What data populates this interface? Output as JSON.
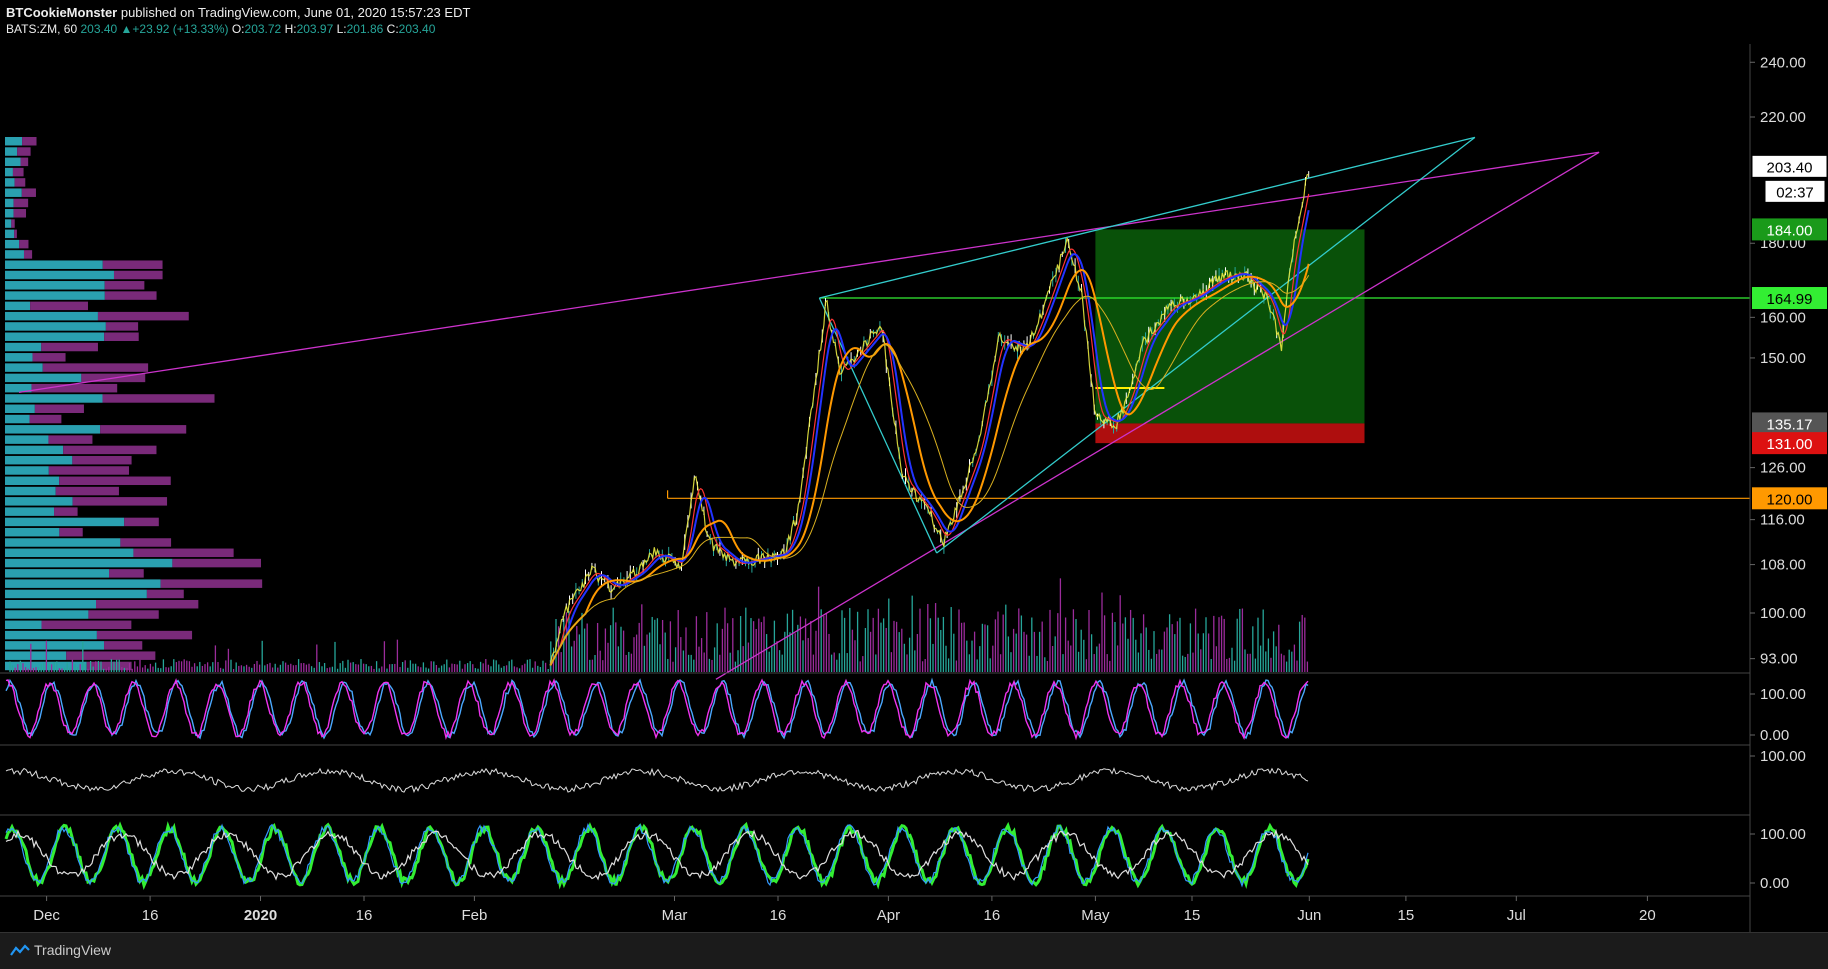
{
  "header": {
    "publisher": "BTCookieMonster",
    "published_text": " published on TradingView.com, June 01, 2020 15:57:23 EDT",
    "symbol_interval": "BATS:ZM, 60",
    "last": "203.40",
    "change": "+23.92 (+13.33%)",
    "o_label": "O:",
    "o_value": "203.72",
    "h_label": "H:",
    "h_value": "203.97",
    "l_label": "L:",
    "l_value": "201.86",
    "c_label": "C:",
    "c_value": "203.40"
  },
  "footer": {
    "brand": "TradingView"
  },
  "colors": {
    "background": "#000000",
    "up_teal": "#26a69a",
    "magenta": "#cc33cc",
    "cyan": "#33cccc",
    "orange": "#ff9900",
    "green_zone": "#0a5a0a",
    "red_zone": "#cc1111",
    "price_box_green": "#1a9a1a",
    "price_box_lime": "#33ee33",
    "price_box_red": "#dd1111",
    "price_box_orange": "#ff9900",
    "price_box_gray": "#555555"
  },
  "chart_data": {
    "type": "line",
    "title": "BATS:ZM, 60",
    "y_axis_ticks": [
      "240.00",
      "220.00",
      "180.00",
      "160.00",
      "150.00",
      "126.00",
      "116.00",
      "108.00",
      "100.00",
      "93.00"
    ],
    "y_scale": "log",
    "ylim": [
      90,
      250
    ],
    "x_axis_ticks": [
      "Dec",
      "16",
      "2020",
      "16",
      "Feb",
      "Mar",
      "16",
      "Apr",
      "16",
      "May",
      "15",
      "Jun",
      "15",
      "Jul",
      "20"
    ],
    "price_labels": [
      {
        "value": "203.40",
        "style": "last"
      },
      {
        "value": "02:37",
        "style": "countdown"
      },
      {
        "value": "184.00",
        "style": "target"
      },
      {
        "value": "164.99",
        "style": "level"
      },
      {
        "value": "135.17",
        "style": "entry"
      },
      {
        "value": "131.00",
        "style": "stop"
      },
      {
        "value": "120.00",
        "style": "support"
      }
    ],
    "price_series": [
      {
        "date": "2019-11-27",
        "price": null
      },
      {
        "date": "2020-01-31",
        "price": null
      },
      {
        "date": "2020-02-12",
        "price": 92
      },
      {
        "date": "2020-02-14",
        "price": 100
      },
      {
        "date": "2020-02-18",
        "price": 107
      },
      {
        "date": "2020-02-21",
        "price": 104
      },
      {
        "date": "2020-02-25",
        "price": 107
      },
      {
        "date": "2020-02-27",
        "price": 110
      },
      {
        "date": "2020-03-02",
        "price": 108
      },
      {
        "date": "2020-03-04",
        "price": 125
      },
      {
        "date": "2020-03-06",
        "price": 112
      },
      {
        "date": "2020-03-10",
        "price": 108
      },
      {
        "date": "2020-03-13",
        "price": 109
      },
      {
        "date": "2020-03-17",
        "price": 110
      },
      {
        "date": "2020-03-19",
        "price": 118
      },
      {
        "date": "2020-03-23",
        "price": 164
      },
      {
        "date": "2020-03-25",
        "price": 146
      },
      {
        "date": "2020-03-27",
        "price": 150
      },
      {
        "date": "2020-03-31",
        "price": 158
      },
      {
        "date": "2020-04-03",
        "price": 124
      },
      {
        "date": "2020-04-07",
        "price": 117
      },
      {
        "date": "2020-04-09",
        "price": 112
      },
      {
        "date": "2020-04-14",
        "price": 130
      },
      {
        "date": "2020-04-17",
        "price": 155
      },
      {
        "date": "2020-04-21",
        "price": 152
      },
      {
        "date": "2020-04-23",
        "price": 160
      },
      {
        "date": "2020-04-27",
        "price": 181
      },
      {
        "date": "2020-04-29",
        "price": 166
      },
      {
        "date": "2020-05-01",
        "price": 137
      },
      {
        "date": "2020-05-04",
        "price": 135
      },
      {
        "date": "2020-05-06",
        "price": 142
      },
      {
        "date": "2020-05-08",
        "price": 154
      },
      {
        "date": "2020-05-12",
        "price": 163
      },
      {
        "date": "2020-05-15",
        "price": 165
      },
      {
        "date": "2020-05-19",
        "price": 170
      },
      {
        "date": "2020-05-22",
        "price": 172
      },
      {
        "date": "2020-05-26",
        "price": 165
      },
      {
        "date": "2020-05-28",
        "price": 152
      },
      {
        "date": "2020-05-29",
        "price": 172
      },
      {
        "date": "2020-06-01",
        "price": 203.4
      }
    ],
    "zones": [
      {
        "name": "target",
        "from": 135.17,
        "to": 184.0,
        "start": "2020-05-01",
        "end": "2020-06-09"
      },
      {
        "name": "stop",
        "from": 131.0,
        "to": 135.17,
        "start": "2020-05-01",
        "end": "2020-06-09"
      }
    ],
    "hlines": [
      {
        "value": 164.99,
        "color": "lime",
        "start": "2020-03-22",
        "end": "end"
      },
      {
        "value": 120.0,
        "color": "orange",
        "start": "2020-02-29",
        "end": "end"
      },
      {
        "value": 143.0,
        "color": "yellow",
        "start": "2020-05-01",
        "end": "2020-05-11"
      }
    ],
    "trendlines": [
      {
        "color": "magenta",
        "from": {
          "date": "2019-11-27",
          "price": 142
        },
        "to": {
          "date": "2020-07-13",
          "price": 208
        }
      },
      {
        "color": "magenta",
        "from": {
          "date": "2020-03-07",
          "price": 90
        },
        "to": {
          "date": "2020-07-13",
          "price": 208
        }
      },
      {
        "color": "cyan",
        "from": {
          "date": "2020-03-22",
          "price": 165
        },
        "to": {
          "date": "2020-06-25",
          "price": 213
        }
      },
      {
        "color": "cyan",
        "from": {
          "date": "2020-03-22",
          "price": 165
        },
        "to": {
          "date": "2020-04-08",
          "price": 110
        }
      },
      {
        "color": "cyan",
        "from": {
          "date": "2020-04-08",
          "price": 110
        },
        "to": {
          "date": "2020-06-25",
          "price": 213
        }
      }
    ],
    "sub_panels": [
      {
        "name": "stoch-rsi",
        "ticks": [
          "100.00",
          "0.00"
        ]
      },
      {
        "name": "rsi",
        "ticks": [
          "100.00"
        ]
      },
      {
        "name": "stochastic",
        "ticks": [
          "100.00",
          "0.00"
        ]
      }
    ]
  }
}
